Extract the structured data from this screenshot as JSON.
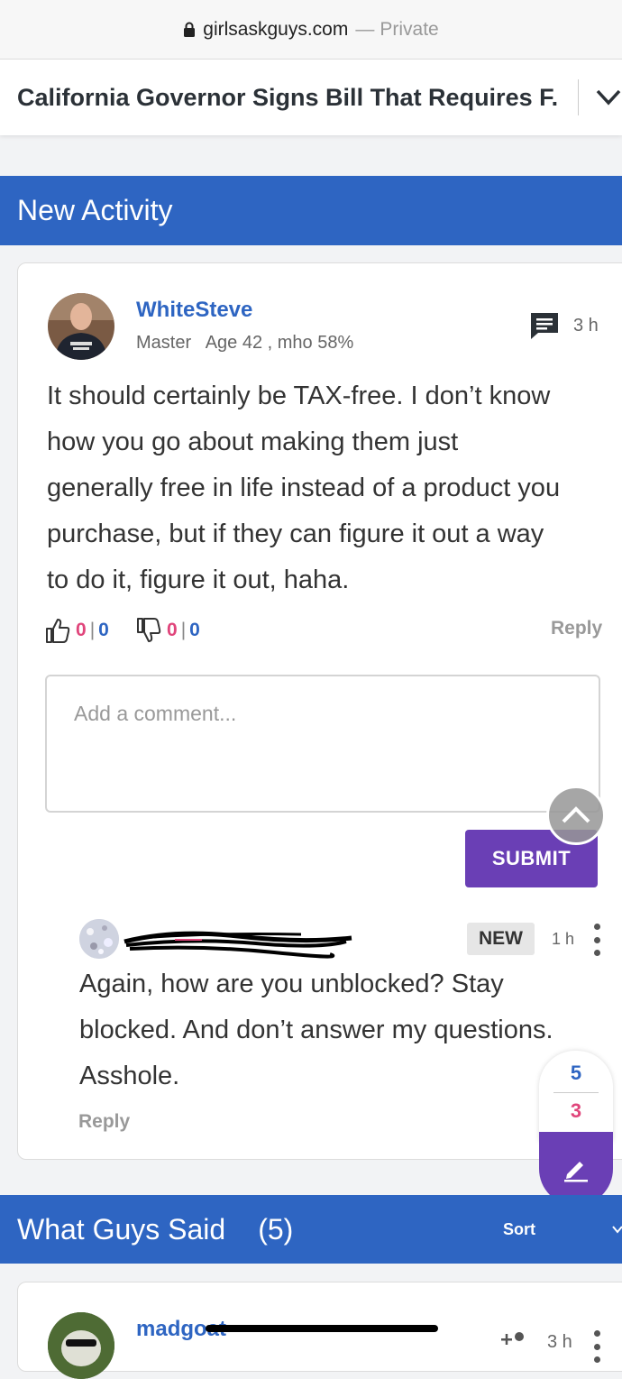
{
  "browser": {
    "domain": "girlsaskguys.com",
    "separator": "—",
    "mode": "Private"
  },
  "page": {
    "title": "California Governor Signs Bill That Requires F..."
  },
  "new_activity": {
    "header": "New Activity",
    "post": {
      "username": "WhiteSteve",
      "rank": "Master",
      "age": "Age 42 , mho 58%",
      "time": "3 h",
      "body_lines": [
        "It should certainly be TAX-free. I don’t know",
        "how you go about making them just",
        "generally free in life instead of a product you",
        "purchase, but if they can figure it out a way",
        "to do it, figure it out, haha."
      ],
      "upvotes": {
        "a": "0",
        "sep": "|",
        "b": "0"
      },
      "downvotes": {
        "a": "0",
        "sep": "|",
        "b": "0"
      },
      "reply_label": "Reply"
    },
    "comment_input": {
      "placeholder": "Add a comment..."
    },
    "submit_label": "SUBMIT",
    "reply_comment": {
      "badge": "NEW",
      "time": "1 h",
      "body_lines": [
        "Again, how are you unblocked? Stay",
        "blocked. And don’t answer my questions.",
        "Asshole."
      ],
      "reply_label": "Reply"
    },
    "vote_counter": {
      "up": "5",
      "down": "3"
    }
  },
  "guys_section": {
    "header": "What Guys Said",
    "count": "(5)",
    "sort_label": "Sort",
    "first_post": {
      "username": "madgoat",
      "time": "3 h"
    }
  },
  "colors": {
    "brand_blue": "#2e65c2",
    "purple": "#6a3fb5",
    "pink": "#e0457b"
  }
}
